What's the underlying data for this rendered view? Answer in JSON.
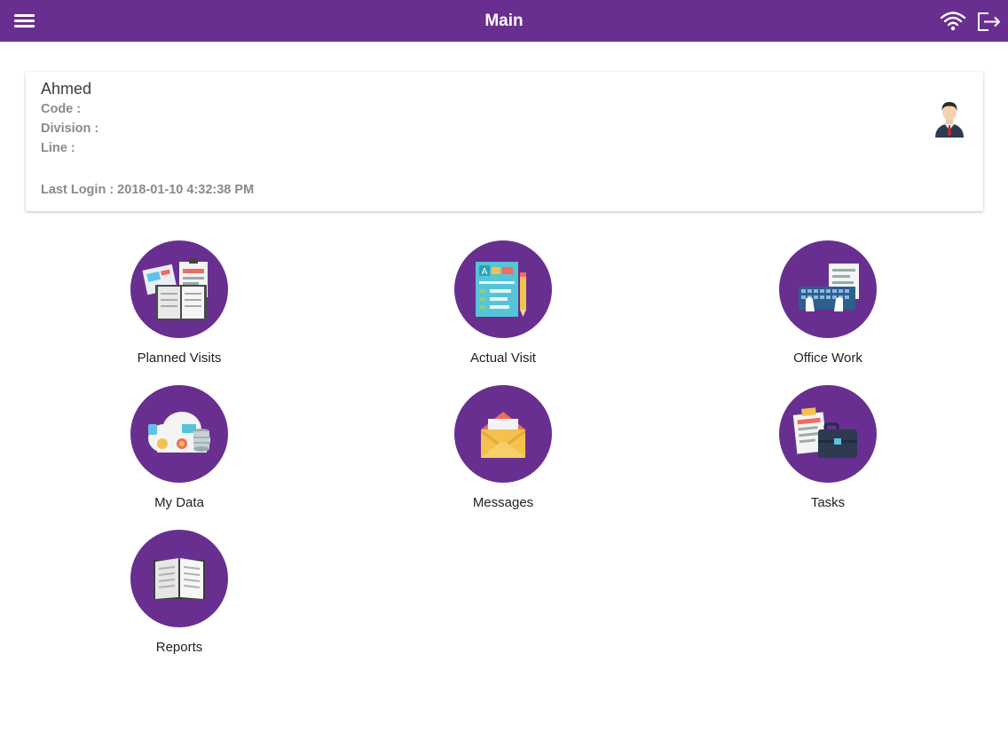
{
  "header": {
    "title": "Main",
    "menu_icon": "hamburger-menu-icon",
    "wifi_icon": "wifi-icon",
    "logout_icon": "logout-icon",
    "bar_color": "#682f90"
  },
  "profile": {
    "name": "Ahmed",
    "code_label": "Code :",
    "division_label": "Division :",
    "line_label": "Line :",
    "last_login": "Last Login : 2018-01-10 4:32:38 PM",
    "avatar_icon": "user-avatar-icon"
  },
  "tiles": [
    {
      "label": "Planned Visits",
      "icon": "planned-visits-icon"
    },
    {
      "label": "Actual Visit",
      "icon": "actual-visit-icon"
    },
    {
      "label": "Office Work",
      "icon": "office-work-icon"
    },
    {
      "label": "My Data",
      "icon": "my-data-icon"
    },
    {
      "label": "Messages",
      "icon": "messages-icon"
    },
    {
      "label": "Tasks",
      "icon": "tasks-icon"
    },
    {
      "label": "Reports",
      "icon": "reports-icon"
    }
  ],
  "colors": {
    "accent": "#682f90",
    "text_muted": "#8a8a8a"
  }
}
